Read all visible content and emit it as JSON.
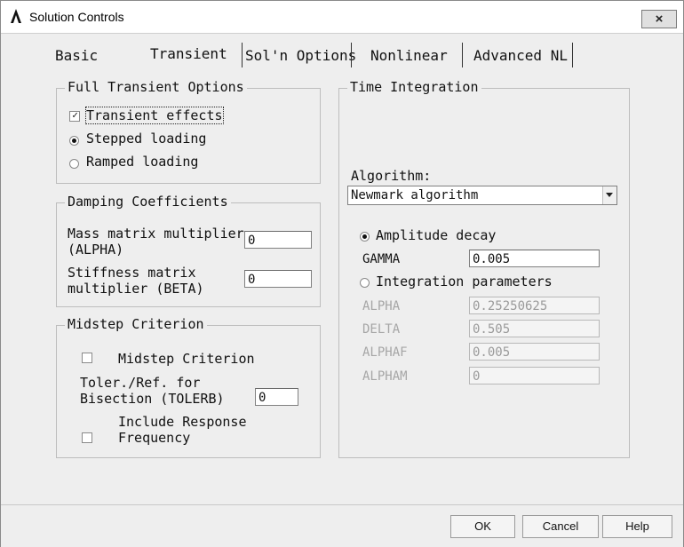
{
  "window": {
    "title": "Solution Controls",
    "close_label": "×"
  },
  "tabs": [
    {
      "label": "Basic"
    },
    {
      "label": "Transient"
    },
    {
      "label": "Sol'n Options"
    },
    {
      "label": "Nonlinear"
    },
    {
      "label": "Advanced NL"
    }
  ],
  "full_transient": {
    "title": "Full Transient Options",
    "transient_effects": {
      "label": "Transient effects",
      "checked": true
    },
    "stepped_loading": {
      "label": "Stepped loading",
      "selected": true
    },
    "ramped_loading": {
      "label": "Ramped loading",
      "selected": false
    }
  },
  "damping": {
    "title": "Damping Coefficients",
    "mass_label_1": "Mass matrix multiplier",
    "mass_label_2": "(ALPHA)",
    "mass_value": "0",
    "stiff_label_1": "Stiffness matrix",
    "stiff_label_2": "multiplier (BETA)",
    "stiff_value": "0"
  },
  "midstep": {
    "title": "Midstep Criterion",
    "criterion_label": "Midstep Criterion",
    "criterion_checked": false,
    "toler_label_1": "Toler./Ref. for",
    "toler_label_2": "Bisection (TOLERB)",
    "toler_value": "0",
    "response_label_1": "Include Response",
    "response_label_2": "Frequency",
    "response_checked": false
  },
  "time_integration": {
    "title": "Time Integration",
    "algorithm_label": "Algorithm:",
    "algorithm_value": "Newmark algorithm",
    "amplitude_decay": {
      "label": "Amplitude decay",
      "selected": true
    },
    "gamma_label": "GAMMA",
    "gamma_value": "0.005",
    "integration_params": {
      "label": "Integration parameters",
      "selected": false
    },
    "alpha_label": "ALPHA",
    "alpha_value": "0.25250625",
    "delta_label": "DELTA",
    "delta_value": "0.505",
    "alphaf_label": "ALPHAF",
    "alphaf_value": "0.005",
    "alpham_label": "ALPHAM",
    "alpham_value": "0"
  },
  "buttons": {
    "ok": "OK",
    "cancel": "Cancel",
    "help": "Help"
  },
  "colors": {
    "window_bg": "#eeeeee",
    "field_bg": "#ffffff",
    "disabled_text": "#a6a6a6"
  }
}
